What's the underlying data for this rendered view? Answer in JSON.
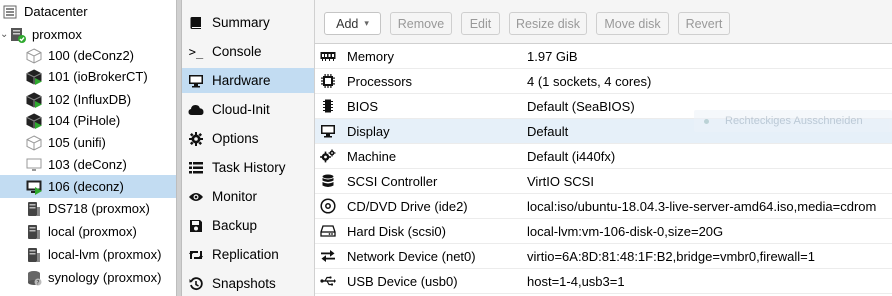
{
  "tree": {
    "datacenter": "Datacenter",
    "node": "proxmox",
    "items": [
      {
        "label": "100 (deConz2)",
        "icon": "container-stopped-icon"
      },
      {
        "label": "101 (ioBrokerCT)",
        "icon": "container-running-icon"
      },
      {
        "label": "102 (InfluxDB)",
        "icon": "container-running-icon"
      },
      {
        "label": "104 (PiHole)",
        "icon": "container-running-icon"
      },
      {
        "label": "105 (unifi)",
        "icon": "container-stopped-icon"
      },
      {
        "label": "103 (deConz)",
        "icon": "vm-stopped-icon"
      },
      {
        "label": "106 (deconz)",
        "icon": "vm-running-icon"
      },
      {
        "label": "DS718 (proxmox)",
        "icon": "storage-icon"
      },
      {
        "label": "local (proxmox)",
        "icon": "storage-icon"
      },
      {
        "label": "local-lvm (proxmox)",
        "icon": "storage-icon"
      },
      {
        "label": "synology (proxmox)",
        "icon": "storage-question-icon"
      }
    ]
  },
  "nav": {
    "items": [
      {
        "label": "Summary",
        "icon": "book-icon"
      },
      {
        "label": "Console",
        "icon": "terminal-icon"
      },
      {
        "label": "Hardware",
        "icon": "desktop-icon"
      },
      {
        "label": "Cloud-Init",
        "icon": "cloud-icon"
      },
      {
        "label": "Options",
        "icon": "gear-icon"
      },
      {
        "label": "Task History",
        "icon": "list-icon"
      },
      {
        "label": "Monitor",
        "icon": "eye-icon"
      },
      {
        "label": "Backup",
        "icon": "floppy-icon"
      },
      {
        "label": "Replication",
        "icon": "retweet-icon"
      },
      {
        "label": "Snapshots",
        "icon": "history-icon"
      }
    ]
  },
  "toolbar": {
    "add": "Add",
    "remove": "Remove",
    "edit": "Edit",
    "resize": "Resize disk",
    "move": "Move disk",
    "revert": "Revert"
  },
  "hardware": [
    {
      "key": "Memory",
      "value": "1.97 GiB",
      "icon": "memory-icon"
    },
    {
      "key": "Processors",
      "value": "4 (1 sockets, 4 cores)",
      "icon": "cpu-icon"
    },
    {
      "key": "BIOS",
      "value": "Default (SeaBIOS)",
      "icon": "microchip-icon"
    },
    {
      "key": "Display",
      "value": "Default",
      "icon": "desktop-icon"
    },
    {
      "key": "Machine",
      "value": "Default (i440fx)",
      "icon": "cogs-icon"
    },
    {
      "key": "SCSI Controller",
      "value": "VirtIO SCSI",
      "icon": "database-icon"
    },
    {
      "key": "CD/DVD Drive (ide2)",
      "value": "local:iso/ubuntu-18.04.3-live-server-amd64.iso,media=cdrom",
      "icon": "cdrom-icon"
    },
    {
      "key": "Hard Disk (scsi0)",
      "value": "local-lvm:vm-106-disk-0,size=20G",
      "icon": "hdd-icon"
    },
    {
      "key": "Network Device (net0)",
      "value": "virtio=6A:8D:81:48:1F:B2,bridge=vmbr0,firewall=1",
      "icon": "exchange-icon"
    },
    {
      "key": "USB Device (usb0)",
      "value": "host=1-4,usb3=1",
      "icon": "usb-icon"
    }
  ],
  "ghost_tooltip": "Rechteckiges Ausschneiden",
  "colors": {
    "selected": "#c2dcf2",
    "running": "#2fa92f",
    "stopped": "#888888",
    "nav_bg": "#f5f5f5"
  }
}
